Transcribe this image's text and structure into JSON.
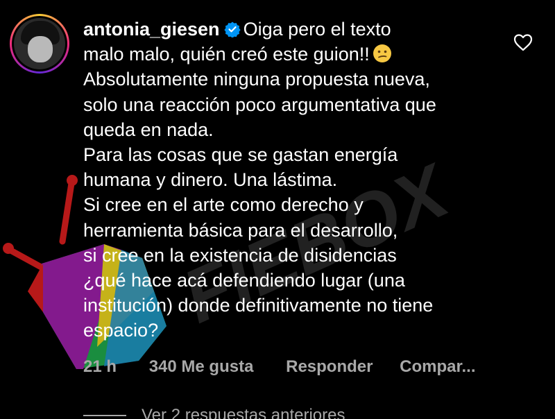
{
  "comment": {
    "username": "antonia_giesen",
    "verified": true,
    "lines": [
      "Oiga pero el texto",
      "malo malo, quién creó este guion!!",
      "Absolutamente ninguna propuesta nueva,",
      "solo una reacción poco argumentativa que",
      "queda en nada.",
      "Para las cosas que se gastan energía",
      "humana y dinero. Una lástima.",
      "Si cree en el arte como derecho y",
      "herramienta básica para el desarrollo,",
      "si cree en la existencia de disidencias",
      "¿qué hace acá defendiendo lugar (una",
      "institución) donde definitivamente no tiene",
      "espacio?"
    ],
    "emoji": "confused-face-icon"
  },
  "actions": {
    "time": "21 h",
    "likes": "340 Me gusta",
    "reply": "Responder",
    "share": "Compar..."
  },
  "replies": {
    "label": "Ver 2 respuestas anteriores"
  },
  "watermark": {
    "text": "FIEBOX"
  },
  "colors": {
    "background": "#000000",
    "text": "#ffffff",
    "muted": "#a8a8a8",
    "verified": "#0095f6"
  }
}
